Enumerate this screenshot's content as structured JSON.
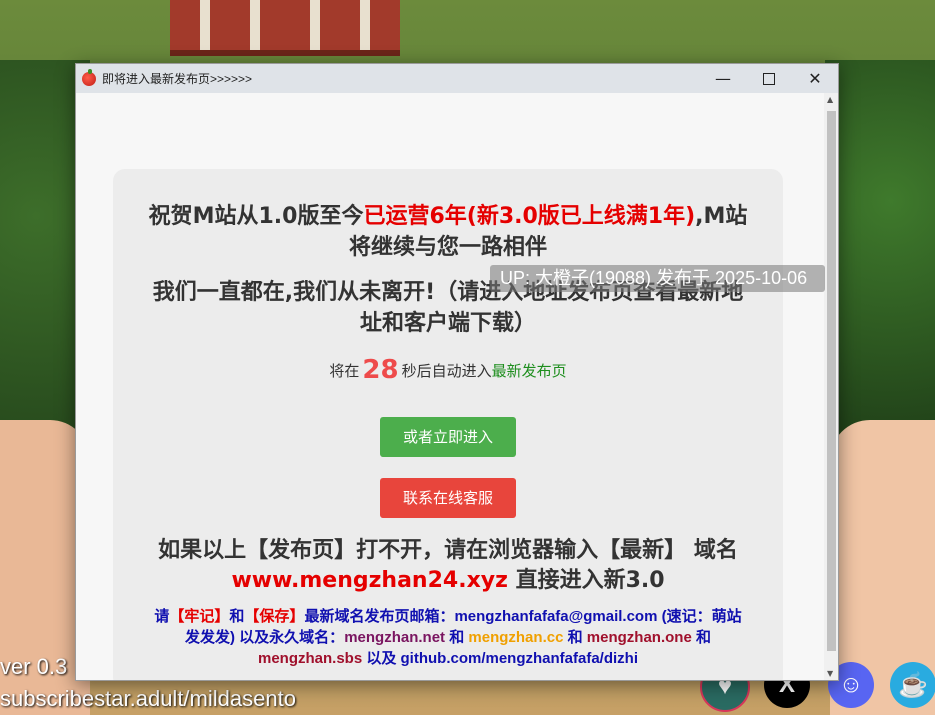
{
  "background": {
    "version_text": "ver 0.3",
    "subscribe_text": "subscribestar.adult/mildasento"
  },
  "window": {
    "title": "即将进入最新发布页>>>>>>",
    "minimize_glyph": "—",
    "close_glyph": "✕"
  },
  "card": {
    "heading_part1": "祝贺M站从1.0版至今",
    "heading_part2_red": "已运营6年(新3.0版已上线满1年)",
    "heading_part3": ",M站将继续与您一路相伴",
    "subheading": "我们一直都在,我们从未离开!（请进入地址发布页查看最新地址和客户端下载）",
    "countdown_prefix": "将在",
    "countdown_value": "28",
    "countdown_suffix": "秒后自动进入",
    "countdown_link": "最新发布页",
    "enter_now_button": "或者立即进入",
    "support_button": "联系在线客服",
    "fallback_line1": "如果以上【发布页】打不开，请在浏览器输入【最新】",
    "fallback_prefix": "域名",
    "fallback_domain": "www.mengzhan24.xyz",
    "fallback_suffix": "直接进入新3.0",
    "note": {
      "t1": "请",
      "t2": "【牢记】",
      "t3": "和",
      "t4": "【保存】",
      "t5": "最新域名发布页邮箱：mengzhanfafafa@gmail.com (速记：萌站发发发) 以及永久域名：",
      "d1": "mengzhan.net",
      "t6": "和",
      "d2": "mengzhan.cc",
      "t7": "和",
      "d3": "mengzhan.one",
      "t8": "和",
      "d4": "mengzhan.sbs",
      "t9": "以及 github.com/mengzhanfafafa/dizhi"
    }
  },
  "up_badge": "UP: 大橙子(19088) 发布于 2025-10-06",
  "social_icons": [
    "kofi-like-icon",
    "x-icon",
    "discord-icon",
    "kofi-icon"
  ],
  "colors": {
    "accent_red": "#e50000",
    "button_green": "#4cae4c",
    "button_red": "#e8453c",
    "note_blue": "#1010b0"
  }
}
